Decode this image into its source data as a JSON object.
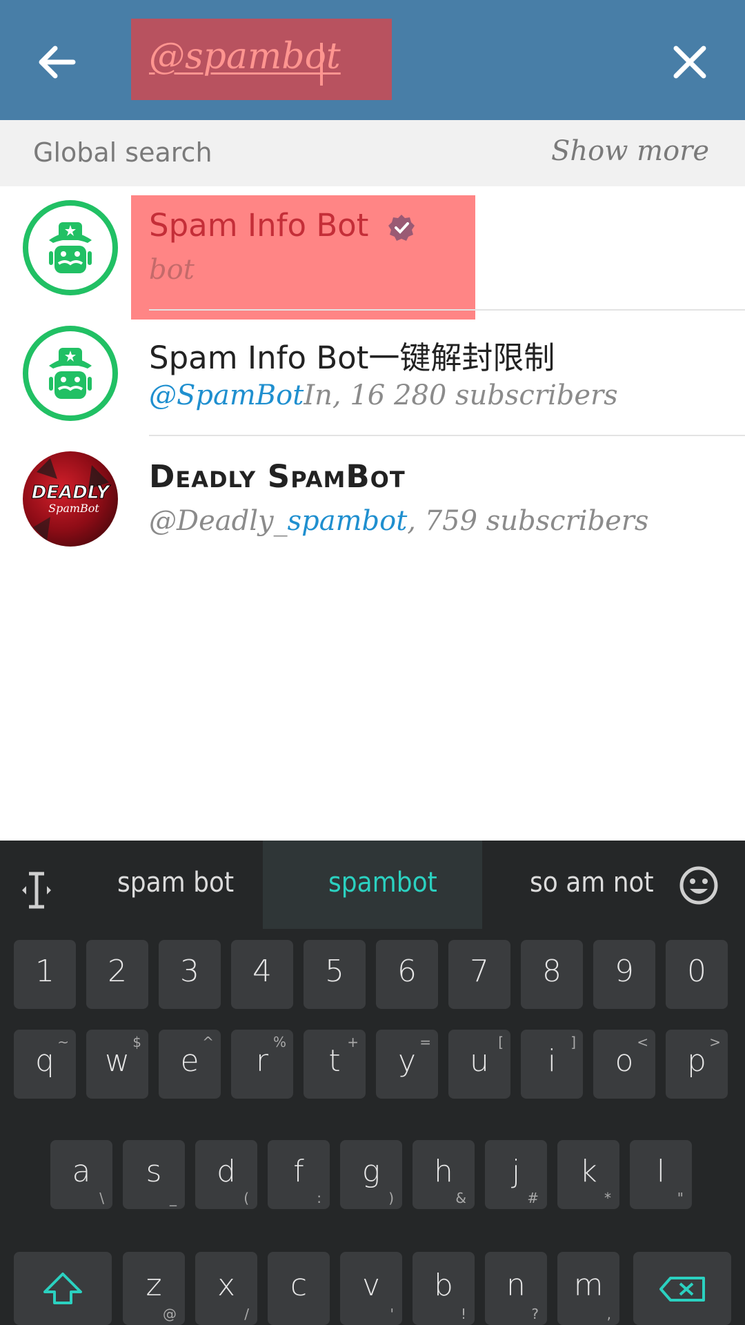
{
  "search": {
    "query": "@spambot"
  },
  "section": {
    "title": "Global search",
    "show_more": "Show more"
  },
  "results": [
    {
      "title": "Spam Info Bot",
      "subtitle_plain": "bot",
      "verified": true
    },
    {
      "title": "Spam Info Bot一键解封限制",
      "subtitle_highlight": "@SpamBot",
      "subtitle_rest": "In, 16 280 subscribers"
    },
    {
      "title": "Deadly SpamBot",
      "subtitle_pre": "@Deadly_",
      "subtitle_highlight": "spambot",
      "subtitle_rest": ", 759 subscribers",
      "avatar_text": "DEADLY SpamBot"
    }
  ],
  "keyboard": {
    "suggestions": [
      "spam bot",
      "spambot",
      "so am not"
    ],
    "numbers": [
      "1",
      "2",
      "3",
      "4",
      "5",
      "6",
      "7",
      "8",
      "9",
      "0"
    ],
    "row_q": [
      {
        "k": "q",
        "a": "~"
      },
      {
        "k": "w",
        "a": "$"
      },
      {
        "k": "e",
        "a": "^"
      },
      {
        "k": "r",
        "a": "%"
      },
      {
        "k": "t",
        "a": "+"
      },
      {
        "k": "y",
        "a": "="
      },
      {
        "k": "u",
        "a": "["
      },
      {
        "k": "i",
        "a": "]"
      },
      {
        "k": "o",
        "a": "<"
      },
      {
        "k": "p",
        "a": ">"
      }
    ],
    "row_a": [
      {
        "k": "a",
        "a": "\\"
      },
      {
        "k": "s",
        "a": "_"
      },
      {
        "k": "d",
        "a": "("
      },
      {
        "k": "f",
        "a": ":"
      },
      {
        "k": "g",
        "a": ")"
      },
      {
        "k": "h",
        "a": "&"
      },
      {
        "k": "j",
        "a": "#"
      },
      {
        "k": "k",
        "a": "*"
      },
      {
        "k": "l",
        "a": "\""
      }
    ],
    "row_z": [
      {
        "k": "z",
        "a": "@"
      },
      {
        "k": "x",
        "a": "/"
      },
      {
        "k": "c",
        "a": ""
      },
      {
        "k": "v",
        "a": "'"
      },
      {
        "k": "b",
        "a": "!"
      },
      {
        "k": "n",
        "a": "?"
      },
      {
        "k": "m",
        "a": ","
      }
    ]
  },
  "colors": {
    "topbar": "#487ea7",
    "accent": "#1f8fcf",
    "highlight": "#ff7b7b",
    "green": "#21c064"
  }
}
